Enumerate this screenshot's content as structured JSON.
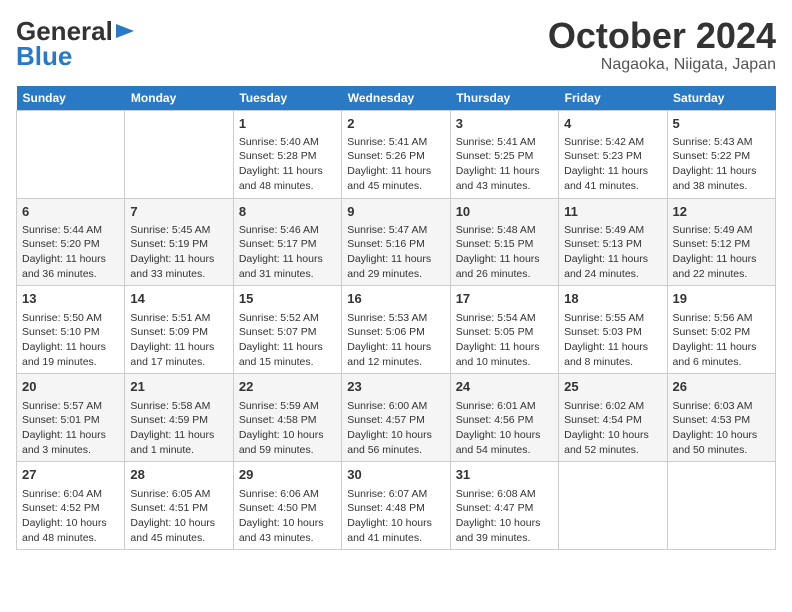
{
  "header": {
    "logo_general": "General",
    "logo_blue": "Blue",
    "title": "October 2024",
    "subtitle": "Nagaoka, Niigata, Japan"
  },
  "weekdays": [
    "Sunday",
    "Monday",
    "Tuesday",
    "Wednesday",
    "Thursday",
    "Friday",
    "Saturday"
  ],
  "weeks": [
    [
      {
        "day": "",
        "sunrise": "",
        "sunset": "",
        "daylight": ""
      },
      {
        "day": "",
        "sunrise": "",
        "sunset": "",
        "daylight": ""
      },
      {
        "day": "1",
        "sunrise": "Sunrise: 5:40 AM",
        "sunset": "Sunset: 5:28 PM",
        "daylight": "Daylight: 11 hours and 48 minutes."
      },
      {
        "day": "2",
        "sunrise": "Sunrise: 5:41 AM",
        "sunset": "Sunset: 5:26 PM",
        "daylight": "Daylight: 11 hours and 45 minutes."
      },
      {
        "day": "3",
        "sunrise": "Sunrise: 5:41 AM",
        "sunset": "Sunset: 5:25 PM",
        "daylight": "Daylight: 11 hours and 43 minutes."
      },
      {
        "day": "4",
        "sunrise": "Sunrise: 5:42 AM",
        "sunset": "Sunset: 5:23 PM",
        "daylight": "Daylight: 11 hours and 41 minutes."
      },
      {
        "day": "5",
        "sunrise": "Sunrise: 5:43 AM",
        "sunset": "Sunset: 5:22 PM",
        "daylight": "Daylight: 11 hours and 38 minutes."
      }
    ],
    [
      {
        "day": "6",
        "sunrise": "Sunrise: 5:44 AM",
        "sunset": "Sunset: 5:20 PM",
        "daylight": "Daylight: 11 hours and 36 minutes."
      },
      {
        "day": "7",
        "sunrise": "Sunrise: 5:45 AM",
        "sunset": "Sunset: 5:19 PM",
        "daylight": "Daylight: 11 hours and 33 minutes."
      },
      {
        "day": "8",
        "sunrise": "Sunrise: 5:46 AM",
        "sunset": "Sunset: 5:17 PM",
        "daylight": "Daylight: 11 hours and 31 minutes."
      },
      {
        "day": "9",
        "sunrise": "Sunrise: 5:47 AM",
        "sunset": "Sunset: 5:16 PM",
        "daylight": "Daylight: 11 hours and 29 minutes."
      },
      {
        "day": "10",
        "sunrise": "Sunrise: 5:48 AM",
        "sunset": "Sunset: 5:15 PM",
        "daylight": "Daylight: 11 hours and 26 minutes."
      },
      {
        "day": "11",
        "sunrise": "Sunrise: 5:49 AM",
        "sunset": "Sunset: 5:13 PM",
        "daylight": "Daylight: 11 hours and 24 minutes."
      },
      {
        "day": "12",
        "sunrise": "Sunrise: 5:49 AM",
        "sunset": "Sunset: 5:12 PM",
        "daylight": "Daylight: 11 hours and 22 minutes."
      }
    ],
    [
      {
        "day": "13",
        "sunrise": "Sunrise: 5:50 AM",
        "sunset": "Sunset: 5:10 PM",
        "daylight": "Daylight: 11 hours and 19 minutes."
      },
      {
        "day": "14",
        "sunrise": "Sunrise: 5:51 AM",
        "sunset": "Sunset: 5:09 PM",
        "daylight": "Daylight: 11 hours and 17 minutes."
      },
      {
        "day": "15",
        "sunrise": "Sunrise: 5:52 AM",
        "sunset": "Sunset: 5:07 PM",
        "daylight": "Daylight: 11 hours and 15 minutes."
      },
      {
        "day": "16",
        "sunrise": "Sunrise: 5:53 AM",
        "sunset": "Sunset: 5:06 PM",
        "daylight": "Daylight: 11 hours and 12 minutes."
      },
      {
        "day": "17",
        "sunrise": "Sunrise: 5:54 AM",
        "sunset": "Sunset: 5:05 PM",
        "daylight": "Daylight: 11 hours and 10 minutes."
      },
      {
        "day": "18",
        "sunrise": "Sunrise: 5:55 AM",
        "sunset": "Sunset: 5:03 PM",
        "daylight": "Daylight: 11 hours and 8 minutes."
      },
      {
        "day": "19",
        "sunrise": "Sunrise: 5:56 AM",
        "sunset": "Sunset: 5:02 PM",
        "daylight": "Daylight: 11 hours and 6 minutes."
      }
    ],
    [
      {
        "day": "20",
        "sunrise": "Sunrise: 5:57 AM",
        "sunset": "Sunset: 5:01 PM",
        "daylight": "Daylight: 11 hours and 3 minutes."
      },
      {
        "day": "21",
        "sunrise": "Sunrise: 5:58 AM",
        "sunset": "Sunset: 4:59 PM",
        "daylight": "Daylight: 11 hours and 1 minute."
      },
      {
        "day": "22",
        "sunrise": "Sunrise: 5:59 AM",
        "sunset": "Sunset: 4:58 PM",
        "daylight": "Daylight: 10 hours and 59 minutes."
      },
      {
        "day": "23",
        "sunrise": "Sunrise: 6:00 AM",
        "sunset": "Sunset: 4:57 PM",
        "daylight": "Daylight: 10 hours and 56 minutes."
      },
      {
        "day": "24",
        "sunrise": "Sunrise: 6:01 AM",
        "sunset": "Sunset: 4:56 PM",
        "daylight": "Daylight: 10 hours and 54 minutes."
      },
      {
        "day": "25",
        "sunrise": "Sunrise: 6:02 AM",
        "sunset": "Sunset: 4:54 PM",
        "daylight": "Daylight: 10 hours and 52 minutes."
      },
      {
        "day": "26",
        "sunrise": "Sunrise: 6:03 AM",
        "sunset": "Sunset: 4:53 PM",
        "daylight": "Daylight: 10 hours and 50 minutes."
      }
    ],
    [
      {
        "day": "27",
        "sunrise": "Sunrise: 6:04 AM",
        "sunset": "Sunset: 4:52 PM",
        "daylight": "Daylight: 10 hours and 48 minutes."
      },
      {
        "day": "28",
        "sunrise": "Sunrise: 6:05 AM",
        "sunset": "Sunset: 4:51 PM",
        "daylight": "Daylight: 10 hours and 45 minutes."
      },
      {
        "day": "29",
        "sunrise": "Sunrise: 6:06 AM",
        "sunset": "Sunset: 4:50 PM",
        "daylight": "Daylight: 10 hours and 43 minutes."
      },
      {
        "day": "30",
        "sunrise": "Sunrise: 6:07 AM",
        "sunset": "Sunset: 4:48 PM",
        "daylight": "Daylight: 10 hours and 41 minutes."
      },
      {
        "day": "31",
        "sunrise": "Sunrise: 6:08 AM",
        "sunset": "Sunset: 4:47 PM",
        "daylight": "Daylight: 10 hours and 39 minutes."
      },
      {
        "day": "",
        "sunrise": "",
        "sunset": "",
        "daylight": ""
      },
      {
        "day": "",
        "sunrise": "",
        "sunset": "",
        "daylight": ""
      }
    ]
  ]
}
